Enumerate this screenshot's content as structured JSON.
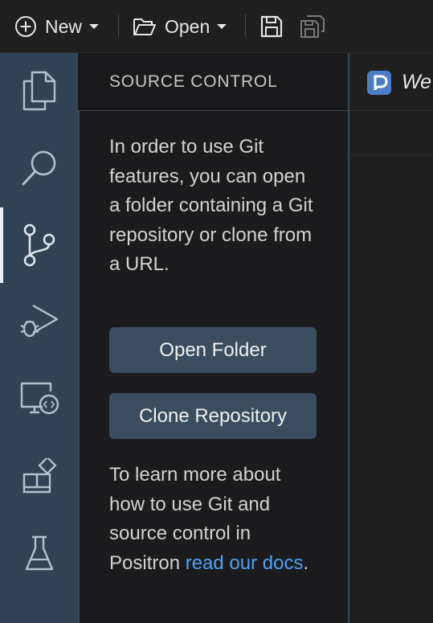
{
  "toolbar": {
    "new_label": "New",
    "open_label": "Open",
    "icons": [
      "plus-circle-icon",
      "chevron-down-icon",
      "folder-open-icon",
      "save-icon",
      "save-all-icon"
    ]
  },
  "activity_bar": {
    "items": [
      {
        "name": "explorer",
        "icon": "files-icon",
        "active": false
      },
      {
        "name": "search",
        "icon": "search-icon",
        "active": false
      },
      {
        "name": "source-control",
        "icon": "source-control-icon",
        "active": true
      },
      {
        "name": "run-and-debug",
        "icon": "debug-icon",
        "active": false
      },
      {
        "name": "remote-explorer",
        "icon": "remote-explorer-icon",
        "active": false
      },
      {
        "name": "extensions",
        "icon": "extensions-icon",
        "active": false
      },
      {
        "name": "testing",
        "icon": "flask-icon",
        "active": false
      }
    ]
  },
  "sidebar": {
    "title": "SOURCE CONTROL",
    "message": "In order to use Git features, you can open a folder containing a Git repository or clone from a URL.",
    "open_folder_label": "Open Folder",
    "clone_repository_label": "Clone Repository",
    "learn_more_prefix": "To learn more about how to use Git and source control in Positron ",
    "learn_more_link": "read our docs",
    "learn_more_suffix": "."
  },
  "editor": {
    "tab_label": "We",
    "tab_icon": "positron-logo-icon"
  },
  "colors": {
    "activity_bar_bg": "#314257",
    "button_bg": "#3b4b60",
    "link": "#4ea1f3",
    "logo_blue": "#4a7fc7"
  }
}
